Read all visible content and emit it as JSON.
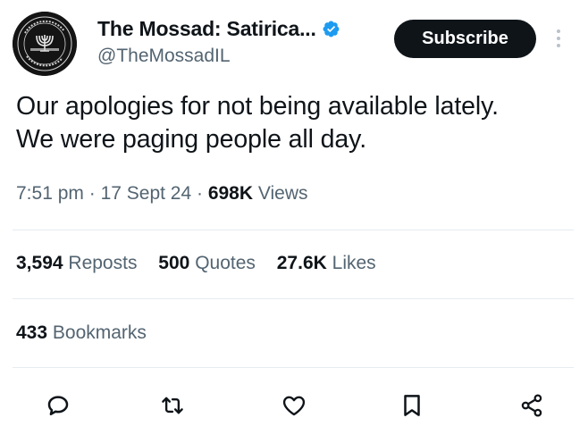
{
  "account": {
    "display_name": "The Mossad: Satirica...",
    "handle": "@TheMossadIL",
    "verified": true,
    "subscribe_label": "Subscribe"
  },
  "tweet": {
    "lines": [
      "Our apologies for not being available lately.",
      "We were paging people all day."
    ],
    "time": "7:51 pm",
    "date": "17 Sept 24",
    "views_count": "698K",
    "views_label": "Views"
  },
  "stats": {
    "reposts_count": "3,594",
    "reposts_label": "Reposts",
    "quotes_count": "500",
    "quotes_label": "Quotes",
    "likes_count": "27.6K",
    "likes_label": "Likes",
    "bookmarks_count": "433",
    "bookmarks_label": "Bookmarks"
  },
  "actions": [
    "reply-icon",
    "repost-icon",
    "like-icon",
    "bookmark-icon",
    "share-icon"
  ],
  "colors": {
    "text": "#0f1419",
    "secondary": "#536471",
    "verified_blue": "#1d9bf0",
    "divider": "#e6ecf0"
  }
}
